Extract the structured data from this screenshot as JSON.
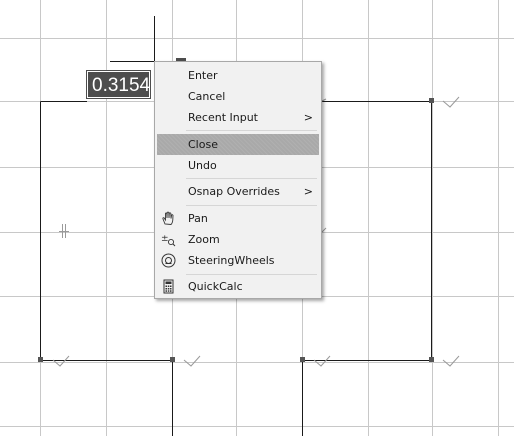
{
  "dynamic_input": {
    "value": "0.3154"
  },
  "context_menu": {
    "items": [
      {
        "label": "Enter",
        "icon": "",
        "submenu": false
      },
      {
        "label": "Cancel",
        "icon": "",
        "submenu": false
      },
      {
        "label": "Recent Input",
        "icon": "",
        "submenu": true
      },
      {
        "label": "Close",
        "icon": "",
        "submenu": false,
        "highlighted": true
      },
      {
        "label": "Undo",
        "icon": "",
        "submenu": false
      },
      {
        "label": "Osnap Overrides",
        "icon": "",
        "submenu": true
      },
      {
        "label": "Pan",
        "icon": "pan-hand-icon",
        "submenu": false
      },
      {
        "label": "Zoom",
        "icon": "zoom-icon",
        "submenu": false
      },
      {
        "label": "SteeringWheels",
        "icon": "steering-wheel-icon",
        "submenu": false
      },
      {
        "label": "QuickCalc",
        "icon": "calculator-icon",
        "submenu": false
      }
    ],
    "submenu_arrow": ">"
  },
  "colors": {
    "grid": "#c8c8c8",
    "geometry": "#1a1a1a",
    "highlight": "#a9a9a9",
    "menu_bg": "#f1f1f1",
    "input_bg": "#4d4d4d"
  }
}
